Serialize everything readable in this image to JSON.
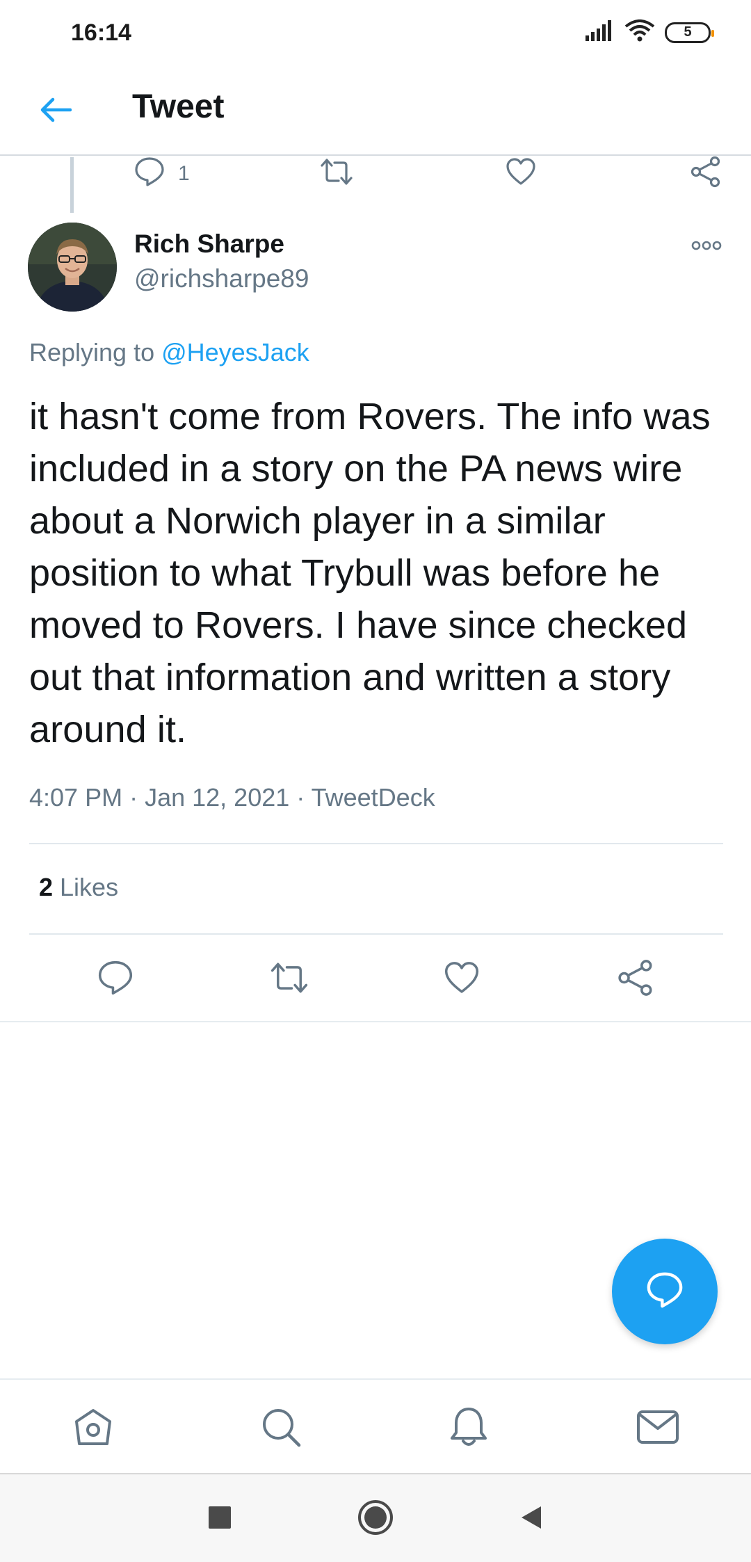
{
  "status_bar": {
    "time": "16:14",
    "battery": "5"
  },
  "header": {
    "title": "Tweet"
  },
  "parent_tweet": {
    "reply_count": "1"
  },
  "tweet": {
    "author_name": "Rich Sharpe",
    "author_handle": "@richsharpe89",
    "replying_prefix": "Replying to ",
    "replying_to": "@HeyesJack",
    "text": "it hasn't come from Rovers. The info was included in a story on the PA news wire about a Norwich player in a similar position to what Trybull was before he moved to Rovers. I have since checked out that information and written a story around it.",
    "time": "4:07 PM",
    "date": "Jan 12, 2021",
    "source": "TweetDeck",
    "likes_count": "2",
    "likes_label": " Likes"
  },
  "colors": {
    "accent": "#1da1f2",
    "secondary_text": "#657786",
    "icon": "#657786"
  },
  "icons": {
    "status": [
      "signal-icon",
      "wifi-icon",
      "battery-icon"
    ],
    "header": [
      "back-arrow-icon"
    ],
    "actions": [
      "reply-icon",
      "retweet-icon",
      "like-icon",
      "share-icon"
    ],
    "more": "more-options-icon",
    "fab": "compose-reply-icon",
    "bottom_nav": [
      "home-icon",
      "search-icon",
      "notifications-icon",
      "messages-icon"
    ],
    "system_nav": [
      "recents-icon",
      "home-system-icon",
      "back-system-icon"
    ]
  }
}
